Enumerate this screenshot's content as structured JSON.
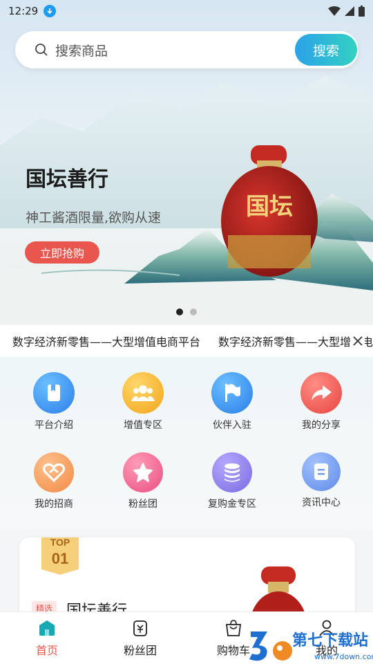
{
  "status_bar": {
    "time": "12:29"
  },
  "search": {
    "placeholder": "搜索商品",
    "button_label": "搜索"
  },
  "banner": {
    "title": "国坛善行",
    "subtitle": "神工酱酒限量,欲购从速",
    "cta_label": "立即抢购",
    "bottle_text": "国坛",
    "slide_count": 2,
    "active_slide": 0
  },
  "notice": {
    "items": [
      "数字经济新零售——大型增值电商平台",
      "数字经济新零售——大型增值电商平台"
    ]
  },
  "quick_menu": {
    "row1": [
      {
        "label": "平台介绍",
        "icon": "book-icon",
        "color": "#2f8ff0"
      },
      {
        "label": "增值专区",
        "icon": "group-icon",
        "color": "#f7b528"
      },
      {
        "label": "伙伴入驻",
        "icon": "flag-icon",
        "color": "#2f8ff0"
      },
      {
        "label": "我的分享",
        "icon": "share-icon",
        "color": "#ee5856"
      }
    ],
    "row2": [
      {
        "label": "我的招商",
        "icon": "handshake-icon",
        "color": "#f49a57"
      },
      {
        "label": "粉丝团",
        "icon": "star-icon",
        "color": "#ee5d88"
      },
      {
        "label": "复购金专区",
        "icon": "coins-icon",
        "color": "#8b7fe6"
      },
      {
        "label": "资讯中心",
        "icon": "document-icon",
        "color": "#6e98ee"
      }
    ]
  },
  "product_card": {
    "badge_top": "TOP",
    "badge_num": "01",
    "tag": "精选",
    "name": "国坛善行"
  },
  "bottom_nav": [
    {
      "label": "首页",
      "icon": "home-icon",
      "active": true
    },
    {
      "label": "粉丝团",
      "icon": "coin-jar-icon",
      "active": false
    },
    {
      "label": "购物车",
      "icon": "shopping-bag-icon",
      "active": false
    },
    {
      "label": "我的",
      "icon": "user-icon",
      "active": false
    }
  ],
  "watermark": {
    "text": "第七下载站",
    "url": "www.7down.com"
  },
  "colors": {
    "accent": "#e8564e",
    "search_gradient_start": "#2aa2e8",
    "search_gradient_end": "#34d1c3"
  }
}
